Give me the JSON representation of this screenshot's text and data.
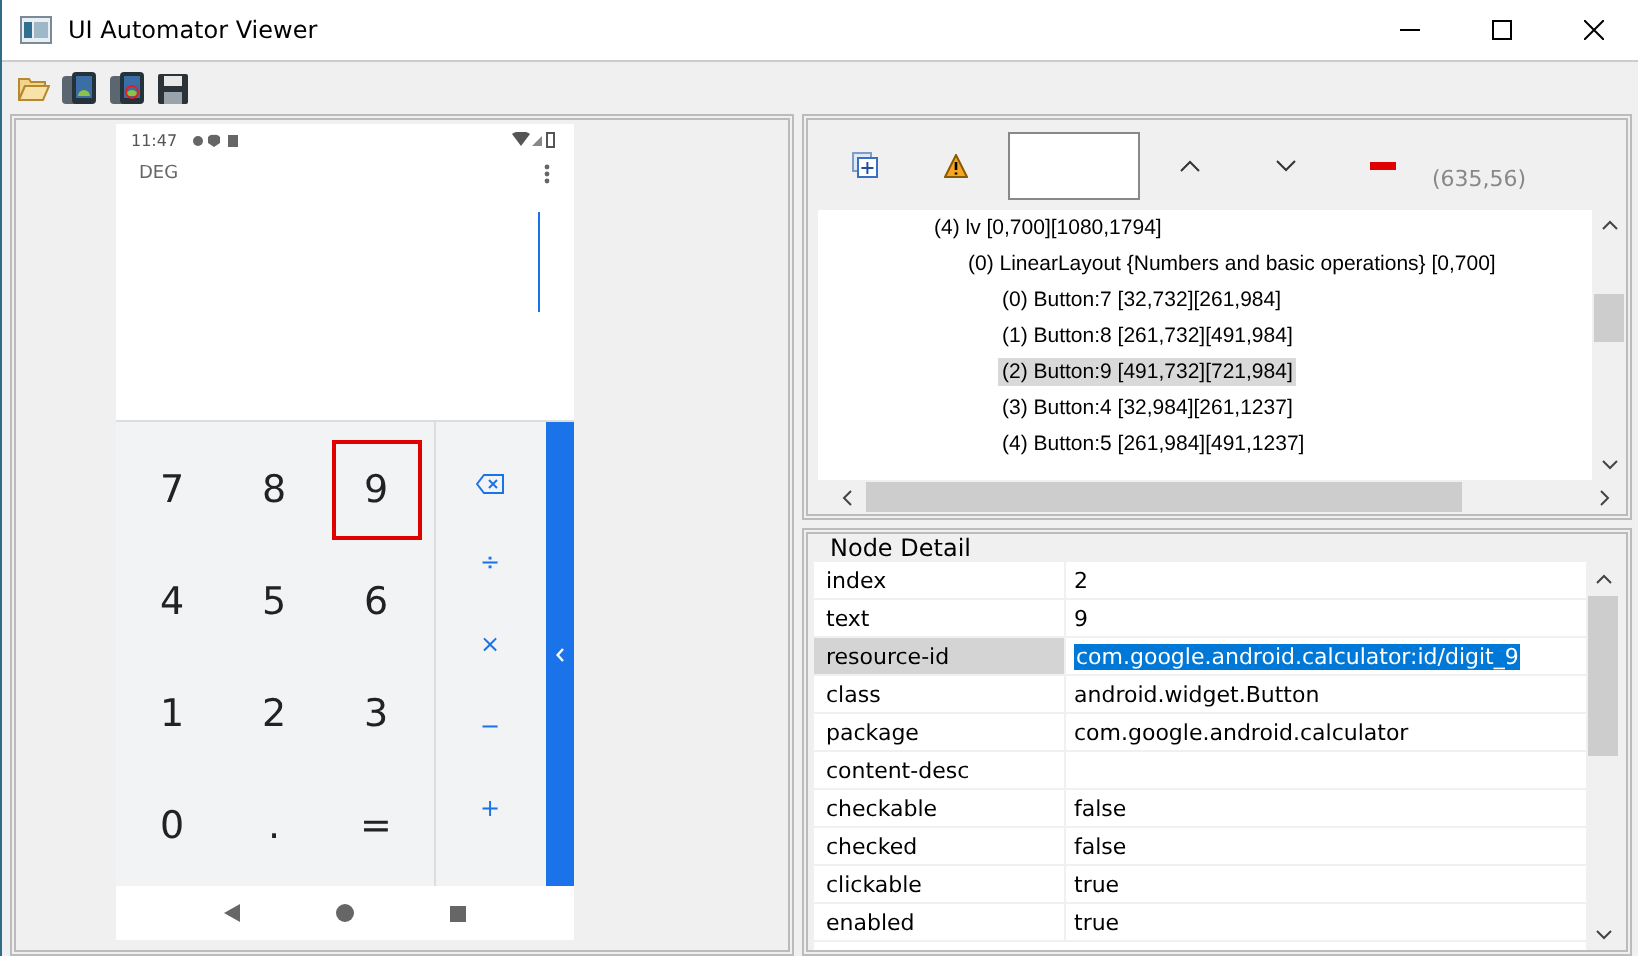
{
  "window": {
    "title": "UI Automator Viewer"
  },
  "device": {
    "status_time": "11:47",
    "mode": "DEG",
    "keys": [
      {
        "label": "7",
        "highlighted": false
      },
      {
        "label": "8",
        "highlighted": false
      },
      {
        "label": "9",
        "highlighted": true
      },
      {
        "label": "4",
        "highlighted": false
      },
      {
        "label": "5",
        "highlighted": false
      },
      {
        "label": "6",
        "highlighted": false
      },
      {
        "label": "1",
        "highlighted": false
      },
      {
        "label": "2",
        "highlighted": false
      },
      {
        "label": "3",
        "highlighted": false
      },
      {
        "label": "0",
        "highlighted": false
      },
      {
        "label": ".",
        "highlighted": false
      },
      {
        "label": "=",
        "highlighted": false
      }
    ],
    "operators": [
      {
        "kind": "backspace"
      },
      {
        "kind": "text",
        "label": "÷"
      },
      {
        "kind": "text",
        "label": "×"
      },
      {
        "kind": "text",
        "label": "−"
      },
      {
        "kind": "text",
        "label": "+"
      }
    ]
  },
  "hierarchy": {
    "coordinates": "(635,56)",
    "tree": [
      {
        "label": "(4) lv [0,700][1080,1794]",
        "selected": false,
        "children": [
          {
            "label": "(0) LinearLayout {Numbers and basic operations} [0,700]",
            "selected": false,
            "children": [
              {
                "label": "(0) Button:7 [32,732][261,984]",
                "selected": false
              },
              {
                "label": "(1) Button:8 [261,732][491,984]",
                "selected": false
              },
              {
                "label": "(2) Button:9 [491,732][721,984]",
                "selected": true
              },
              {
                "label": "(3) Button:4 [32,984][261,1237]",
                "selected": false
              },
              {
                "label": "(4) Button:5 [261,984][491,1237]",
                "selected": false
              }
            ]
          }
        ]
      }
    ]
  },
  "node_detail": {
    "title": "Node Detail",
    "rows": [
      {
        "key": "index",
        "value": "2",
        "selected": false
      },
      {
        "key": "text",
        "value": "9",
        "selected": false
      },
      {
        "key": "resource-id",
        "value": "com.google.android.calculator:id/digit_9",
        "selected": true
      },
      {
        "key": "class",
        "value": "android.widget.Button",
        "selected": false
      },
      {
        "key": "package",
        "value": "com.google.android.calculator",
        "selected": false
      },
      {
        "key": "content-desc",
        "value": "",
        "selected": false
      },
      {
        "key": "checkable",
        "value": "false",
        "selected": false
      },
      {
        "key": "checked",
        "value": "false",
        "selected": false
      },
      {
        "key": "clickable",
        "value": "true",
        "selected": false
      },
      {
        "key": "enabled",
        "value": "true",
        "selected": false
      }
    ]
  }
}
